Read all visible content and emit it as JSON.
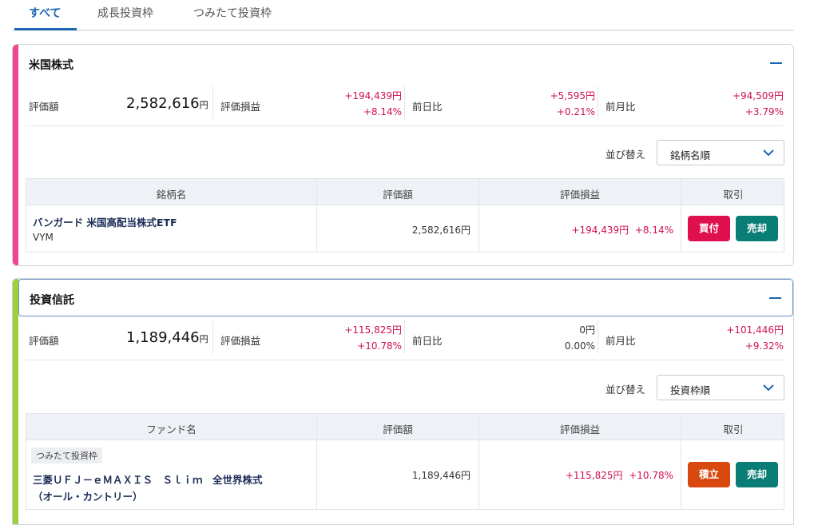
{
  "tabs": [
    {
      "label": "すべて",
      "active": true
    },
    {
      "label": "成長投資枠",
      "active": false
    },
    {
      "label": "つみたて投資枠",
      "active": false
    }
  ],
  "sections": [
    {
      "title": "米国株式",
      "accent_color": "#f0468f",
      "summary": {
        "value_label": "評価額",
        "value": "2,582,616",
        "unit": "円",
        "pl_label": "評価損益",
        "pl_amount": "+194,439円",
        "pl_percent": "+8.14%",
        "day_label": "前日比",
        "day_amount": "+5,595円",
        "day_percent": "+0.21%",
        "month_label": "前月比",
        "month_amount": "+94,509円",
        "month_percent": "+3.79%"
      },
      "sort_label": "並び替え",
      "sort_value": "銘柄名順",
      "columns": [
        "銘柄名",
        "評価額",
        "評価損益",
        "取引"
      ],
      "rows": [
        {
          "name": "バンガード 米国高配当株式ETF",
          "code": "VYM",
          "value": "2,582,616円",
          "pl_amount": "+194,439円",
          "pl_percent": "+8.14%",
          "buttons": [
            "買付",
            "売却"
          ]
        }
      ]
    },
    {
      "title": "投資信託",
      "accent_color": "#9dd03a",
      "summary": {
        "value_label": "評価額",
        "value": "1,189,446",
        "unit": "円",
        "pl_label": "評価損益",
        "pl_amount": "+115,825円",
        "pl_percent": "+10.78%",
        "day_label": "前日比",
        "day_amount": "0円",
        "day_percent": "0.00%",
        "month_label": "前月比",
        "month_amount": "+101,446円",
        "month_percent": "+9.32%"
      },
      "sort_label": "並び替え",
      "sort_value": "投資枠順",
      "columns": [
        "ファンド名",
        "評価額",
        "評価損益",
        "取引"
      ],
      "rows": [
        {
          "badge": "つみたて投資枠",
          "name_line1": "三菱ＵＦＪ－ｅＭＡＸＩＳ　Ｓｌｉｍ　全世界株式",
          "name_line2": "（オール・カントリー）",
          "value": "1,189,446円",
          "pl_amount": "+115,825円",
          "pl_percent": "+10.78%",
          "buttons": [
            "積立",
            "売却"
          ]
        }
      ]
    }
  ],
  "colors": {
    "primary": "#1a66b3",
    "positive": "#d0104c",
    "buy": "#e0104f",
    "sell": "#0a7d76",
    "tsumitate": "#d9480f"
  },
  "icons": {
    "collapse": "minus-icon",
    "select": "chevron-down-icon"
  }
}
